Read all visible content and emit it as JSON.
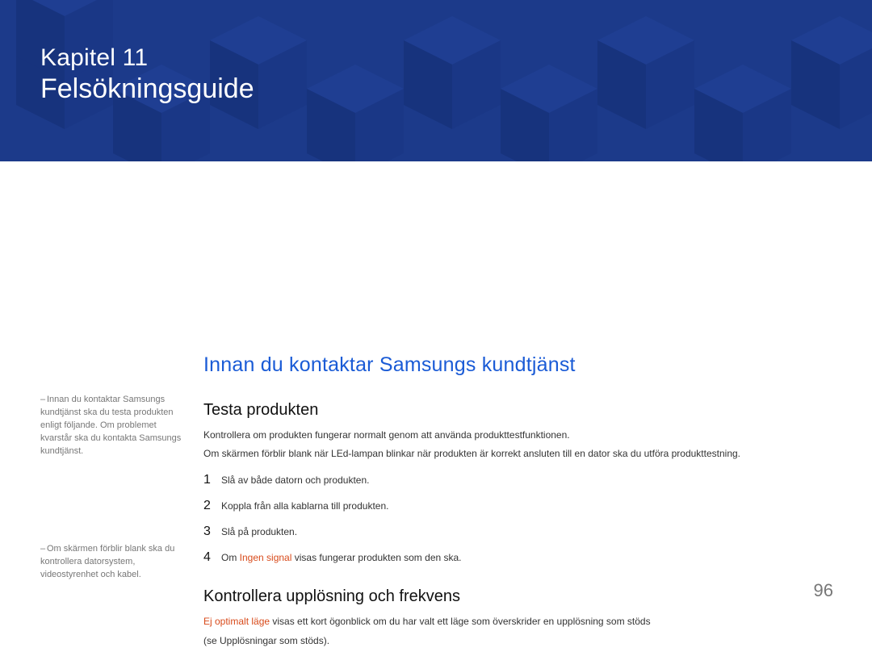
{
  "banner": {
    "chapter": "Kapitel 11",
    "section": "Felsökningsguide"
  },
  "notes": {
    "n1": "Innan du kontaktar Samsungs kundtjänst ska du testa produkten enligt följande. Om problemet kvarstår ska du kontakta Samsungs kundtjänst.",
    "n2": "Om skärmen förblir blank ska du kontrollera datorsystem, videostyrenhet och kabel."
  },
  "main": {
    "heading": "Innan du kontaktar Samsungs kundtjänst",
    "sub1": "Testa produkten",
    "p1": "Kontrollera om produkten fungerar normalt genom att använda produkttestfunktionen.",
    "p2": "Om skärmen förblir blank när LEd-lampan blinkar när produkten är korrekt ansluten till en dator ska du utföra produkttestning.",
    "steps": [
      {
        "n": "1",
        "text": "Slå av både datorn och produkten."
      },
      {
        "n": "2",
        "text": "Koppla från alla kablarna till produkten."
      },
      {
        "n": "3",
        "text": "Slå på produkten."
      },
      {
        "n": "4",
        "prefix": "Om ",
        "warn": "Ingen signal",
        "suffix": " visas fungerar produkten som den ska."
      }
    ],
    "sub2": "Kontrollera upplösning och frekvens",
    "p3warn": "Ej optimalt läge",
    "p3rest": " visas ett kort ögonblick om du har valt ett läge som överskrider en upplösning som stöds",
    "p4": "(se Upplösningar som stöds)."
  },
  "page_number": "96"
}
